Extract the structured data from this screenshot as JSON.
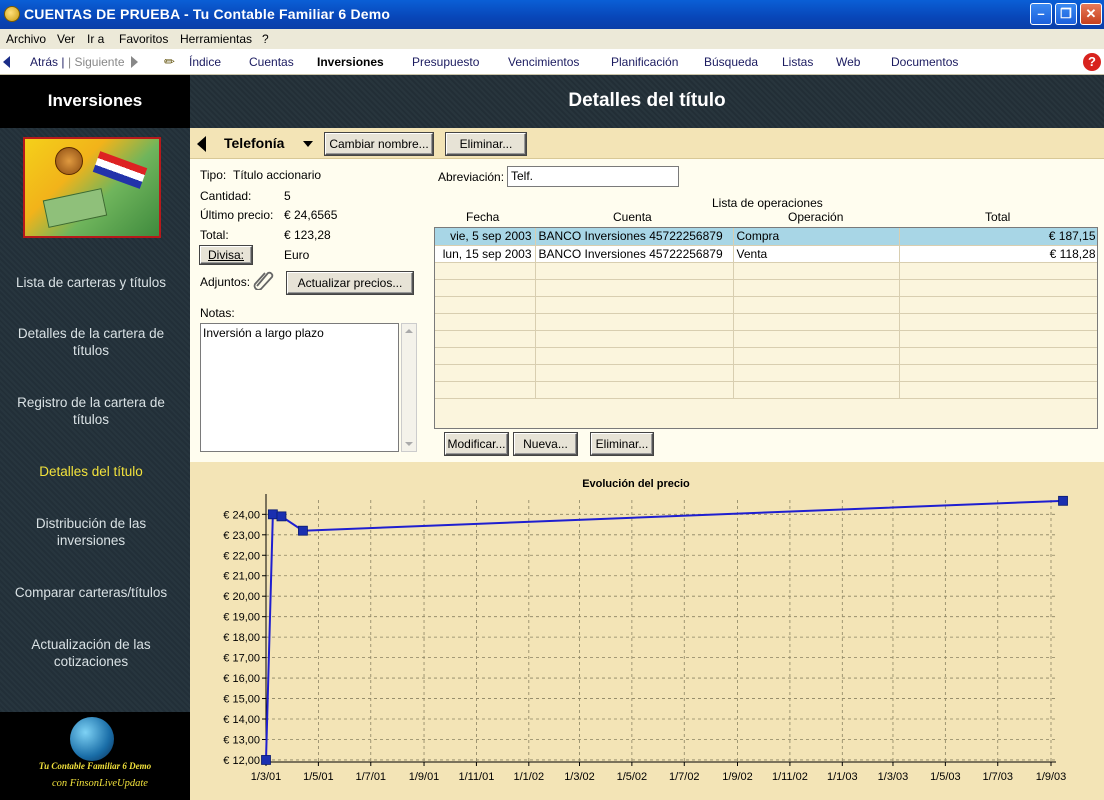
{
  "window": {
    "title": "CUENTAS DE PRUEBA - Tu Contable Familiar 6 Demo"
  },
  "menu": [
    "Archivo",
    "Ver",
    "Ir a",
    "Favoritos",
    "Herramientas",
    "?"
  ],
  "nav": {
    "back": "Atrás |",
    "next": "| Siguiente",
    "items": [
      "Índice",
      "Cuentas",
      "Inversiones",
      "Presupuesto",
      "Vencimientos",
      "Planificación",
      "Búsqueda",
      "Listas",
      "Web",
      "Documentos"
    ],
    "active": "Inversiones",
    "help": "?"
  },
  "sidebar": {
    "title": "Inversiones",
    "items": [
      {
        "label": "Lista de carteras y títulos",
        "lines": [
          "Lista de carteras y títulos"
        ]
      },
      {
        "label": "Detalles de la cartera de títulos",
        "lines": [
          "Detalles de la cartera de",
          "títulos"
        ]
      },
      {
        "label": "Registro de la cartera de títulos",
        "lines": [
          "Registro de la cartera de",
          "títulos"
        ]
      },
      {
        "label": "Detalles del título",
        "lines": [
          "Detalles del título"
        ],
        "active": true
      },
      {
        "label": "Distribución de las inversiones",
        "lines": [
          "Distribución de las",
          "inversiones"
        ]
      },
      {
        "label": "Comparar carteras/títulos",
        "lines": [
          "Comparar carteras/títulos"
        ]
      },
      {
        "label": "Actualización de las cotizaciones",
        "lines": [
          "Actualización de las",
          "cotizaciones"
        ]
      }
    ],
    "brand_line1": "Tu Contable Familiar 6 Demo",
    "brand_line2": "con FinsonLiveUpdate"
  },
  "header": {
    "title": "Detalles del título"
  },
  "toolbar": {
    "security_name": "Telefonía",
    "rename_button": "Cambiar nombre...",
    "delete_button": "Eliminar..."
  },
  "details": {
    "tipo_label": "Tipo:",
    "tipo_value": "Título accionario",
    "cantidad_label": "Cantidad:",
    "cantidad_value": "5",
    "ultimo_precio_label": "Último precio:",
    "ultimo_precio_value": "€ 24,6565",
    "total_label": "Total:",
    "total_value": "€ 123,28",
    "divisa_button": "Divisa:",
    "divisa_value": "Euro",
    "adjuntos_label": "Adjuntos:",
    "update_prices_button": "Actualizar precios...",
    "notas_label": "Notas:",
    "notas_value": "Inversión a largo plazo",
    "abreviacion_label": "Abreviación:",
    "abreviacion_value": "Telf."
  },
  "operations": {
    "title": "Lista de operaciones",
    "columns": [
      "Fecha",
      "Cuenta",
      "Operación",
      "Total"
    ],
    "rows": [
      {
        "fecha": "vie, 5 sep 2003",
        "cuenta": "BANCO Inversiones 45722256879",
        "operacion": "Compra",
        "total": "€ 187,15"
      },
      {
        "fecha": "lun, 15 sep 2003",
        "cuenta": "BANCO Inversiones 45722256879",
        "operacion": "Venta",
        "total": "€ 118,28"
      }
    ],
    "empty_rows": 8,
    "modify_button": "Modificar...",
    "new_button": "Nueva...",
    "delete_button": "Eliminar..."
  },
  "chart_data": {
    "type": "line",
    "title": "Evolución del precio",
    "xlabel": "",
    "ylabel": "",
    "x_ticks": [
      "1/3/01",
      "1/5/01",
      "1/7/01",
      "1/9/01",
      "1/11/01",
      "1/1/02",
      "1/3/02",
      "1/5/02",
      "1/7/02",
      "1/9/02",
      "1/11/02",
      "1/1/03",
      "1/3/03",
      "1/5/03",
      "1/7/03",
      "1/9/03"
    ],
    "y_ticks": [
      "€ 12,00",
      "€ 13,00",
      "€ 14,00",
      "€ 15,00",
      "€ 16,00",
      "€ 17,00",
      "€ 18,00",
      "€ 19,00",
      "€ 20,00",
      "€ 21,00",
      "€ 22,00",
      "€ 23,00",
      "€ 24,00"
    ],
    "ylim": [
      11.9,
      24.7
    ],
    "x_range": [
      "2001-03-01",
      "2003-09-01"
    ],
    "grid": true,
    "color": "#1f1fd0",
    "marker_color": "#1a2fb0",
    "series": [
      {
        "x": [
          "2001-03-01",
          "2001-03-09",
          "2001-03-19",
          "2001-04-13",
          "2003-09-15"
        ],
        "y": [
          12.0,
          24.0,
          23.9,
          23.2,
          24.66
        ]
      }
    ]
  }
}
